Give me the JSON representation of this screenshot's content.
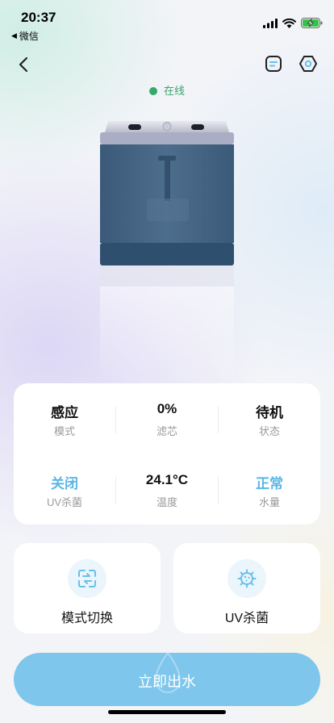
{
  "status_bar": {
    "time": "20:37",
    "back_app": "微信",
    "icons": [
      "signal-icon",
      "wifi-icon",
      "battery-charging-icon"
    ]
  },
  "nav": {
    "back_icon": "chevron-left-icon",
    "doc_icon": "document-icon",
    "settings_icon": "settings-hex-icon"
  },
  "device": {
    "status": "在线",
    "status_color": "#35a86b"
  },
  "info": {
    "row1": [
      {
        "value": "感应",
        "label": "模式",
        "highlight": false
      },
      {
        "value": "0%",
        "label": "滤芯",
        "highlight": false
      },
      {
        "value": "待机",
        "label": "状态",
        "highlight": false
      }
    ],
    "row2": [
      {
        "value": "关闭",
        "label": "UV杀菌",
        "highlight": true
      },
      {
        "value": "24.1°C",
        "label": "温度",
        "highlight": false
      },
      {
        "value": "正常",
        "label": "水量",
        "highlight": true
      }
    ],
    "highlight_color": "#5ab6e6"
  },
  "actions": [
    {
      "label": "模式切换",
      "icon": "mode-switch-icon"
    },
    {
      "label": "UV杀菌",
      "icon": "virus-icon"
    }
  ],
  "primary_button": {
    "label": "立即出水",
    "color": "#7ec6ec"
  }
}
